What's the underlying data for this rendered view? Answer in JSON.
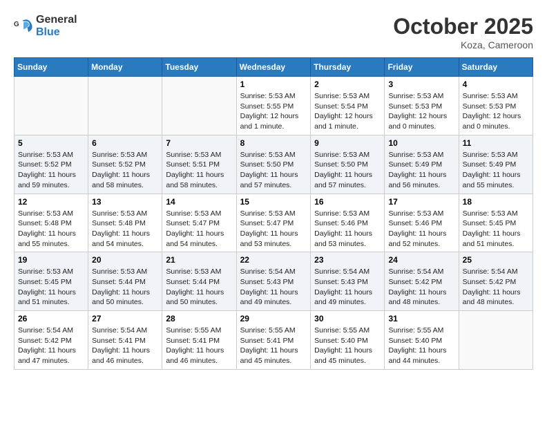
{
  "header": {
    "logo_text_general": "General",
    "logo_text_blue": "Blue",
    "month_title": "October 2025",
    "location": "Koza, Cameroon"
  },
  "weekdays": [
    "Sunday",
    "Monday",
    "Tuesday",
    "Wednesday",
    "Thursday",
    "Friday",
    "Saturday"
  ],
  "weeks": [
    [
      {
        "day": "",
        "info": ""
      },
      {
        "day": "",
        "info": ""
      },
      {
        "day": "",
        "info": ""
      },
      {
        "day": "1",
        "info": "Sunrise: 5:53 AM\nSunset: 5:55 PM\nDaylight: 12 hours\nand 1 minute."
      },
      {
        "day": "2",
        "info": "Sunrise: 5:53 AM\nSunset: 5:54 PM\nDaylight: 12 hours\nand 1 minute."
      },
      {
        "day": "3",
        "info": "Sunrise: 5:53 AM\nSunset: 5:53 PM\nDaylight: 12 hours\nand 0 minutes."
      },
      {
        "day": "4",
        "info": "Sunrise: 5:53 AM\nSunset: 5:53 PM\nDaylight: 12 hours\nand 0 minutes."
      }
    ],
    [
      {
        "day": "5",
        "info": "Sunrise: 5:53 AM\nSunset: 5:52 PM\nDaylight: 11 hours\nand 59 minutes."
      },
      {
        "day": "6",
        "info": "Sunrise: 5:53 AM\nSunset: 5:52 PM\nDaylight: 11 hours\nand 58 minutes."
      },
      {
        "day": "7",
        "info": "Sunrise: 5:53 AM\nSunset: 5:51 PM\nDaylight: 11 hours\nand 58 minutes."
      },
      {
        "day": "8",
        "info": "Sunrise: 5:53 AM\nSunset: 5:50 PM\nDaylight: 11 hours\nand 57 minutes."
      },
      {
        "day": "9",
        "info": "Sunrise: 5:53 AM\nSunset: 5:50 PM\nDaylight: 11 hours\nand 57 minutes."
      },
      {
        "day": "10",
        "info": "Sunrise: 5:53 AM\nSunset: 5:49 PM\nDaylight: 11 hours\nand 56 minutes."
      },
      {
        "day": "11",
        "info": "Sunrise: 5:53 AM\nSunset: 5:49 PM\nDaylight: 11 hours\nand 55 minutes."
      }
    ],
    [
      {
        "day": "12",
        "info": "Sunrise: 5:53 AM\nSunset: 5:48 PM\nDaylight: 11 hours\nand 55 minutes."
      },
      {
        "day": "13",
        "info": "Sunrise: 5:53 AM\nSunset: 5:48 PM\nDaylight: 11 hours\nand 54 minutes."
      },
      {
        "day": "14",
        "info": "Sunrise: 5:53 AM\nSunset: 5:47 PM\nDaylight: 11 hours\nand 54 minutes."
      },
      {
        "day": "15",
        "info": "Sunrise: 5:53 AM\nSunset: 5:47 PM\nDaylight: 11 hours\nand 53 minutes."
      },
      {
        "day": "16",
        "info": "Sunrise: 5:53 AM\nSunset: 5:46 PM\nDaylight: 11 hours\nand 53 minutes."
      },
      {
        "day": "17",
        "info": "Sunrise: 5:53 AM\nSunset: 5:46 PM\nDaylight: 11 hours\nand 52 minutes."
      },
      {
        "day": "18",
        "info": "Sunrise: 5:53 AM\nSunset: 5:45 PM\nDaylight: 11 hours\nand 51 minutes."
      }
    ],
    [
      {
        "day": "19",
        "info": "Sunrise: 5:53 AM\nSunset: 5:45 PM\nDaylight: 11 hours\nand 51 minutes."
      },
      {
        "day": "20",
        "info": "Sunrise: 5:53 AM\nSunset: 5:44 PM\nDaylight: 11 hours\nand 50 minutes."
      },
      {
        "day": "21",
        "info": "Sunrise: 5:53 AM\nSunset: 5:44 PM\nDaylight: 11 hours\nand 50 minutes."
      },
      {
        "day": "22",
        "info": "Sunrise: 5:54 AM\nSunset: 5:43 PM\nDaylight: 11 hours\nand 49 minutes."
      },
      {
        "day": "23",
        "info": "Sunrise: 5:54 AM\nSunset: 5:43 PM\nDaylight: 11 hours\nand 49 minutes."
      },
      {
        "day": "24",
        "info": "Sunrise: 5:54 AM\nSunset: 5:42 PM\nDaylight: 11 hours\nand 48 minutes."
      },
      {
        "day": "25",
        "info": "Sunrise: 5:54 AM\nSunset: 5:42 PM\nDaylight: 11 hours\nand 48 minutes."
      }
    ],
    [
      {
        "day": "26",
        "info": "Sunrise: 5:54 AM\nSunset: 5:42 PM\nDaylight: 11 hours\nand 47 minutes."
      },
      {
        "day": "27",
        "info": "Sunrise: 5:54 AM\nSunset: 5:41 PM\nDaylight: 11 hours\nand 46 minutes."
      },
      {
        "day": "28",
        "info": "Sunrise: 5:55 AM\nSunset: 5:41 PM\nDaylight: 11 hours\nand 46 minutes."
      },
      {
        "day": "29",
        "info": "Sunrise: 5:55 AM\nSunset: 5:41 PM\nDaylight: 11 hours\nand 45 minutes."
      },
      {
        "day": "30",
        "info": "Sunrise: 5:55 AM\nSunset: 5:40 PM\nDaylight: 11 hours\nand 45 minutes."
      },
      {
        "day": "31",
        "info": "Sunrise: 5:55 AM\nSunset: 5:40 PM\nDaylight: 11 hours\nand 44 minutes."
      },
      {
        "day": "",
        "info": ""
      }
    ]
  ]
}
